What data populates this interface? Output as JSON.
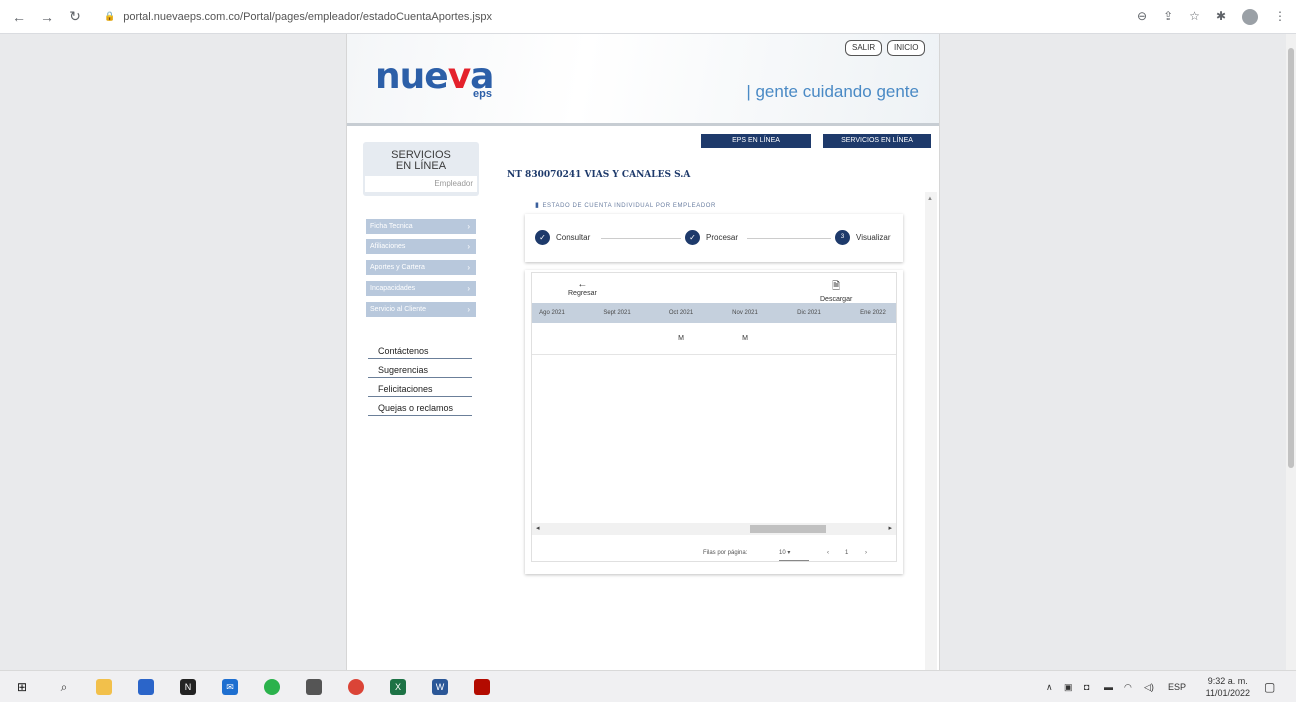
{
  "browser": {
    "url": "portal.nuevaeps.com.co/Portal/pages/empleador/estadoCuentaAportes.jspx"
  },
  "header": {
    "logo_text_main": "nue",
    "logo_text_v": "v",
    "logo_text_end": "a",
    "logo_eps": "eps",
    "slogan": "| gente cuidando gente",
    "salir_label": "SALIR",
    "inicio_label": "INICIO"
  },
  "sidebar": {
    "services_title_line1": "SERVICIOS",
    "services_title_line2": "EN LÍNEA",
    "services_sub": "Empleador",
    "menu": [
      {
        "label": "Ficha Tecnica"
      },
      {
        "label": "Afiliaciones"
      },
      {
        "label": "Aportes y Cartera"
      },
      {
        "label": "Incapacidades"
      },
      {
        "label": "Servicio al Cliente"
      }
    ],
    "links": [
      {
        "label": "Contáctenos"
      },
      {
        "label": "Sugerencias"
      },
      {
        "label": "Felicitaciones"
      },
      {
        "label": "Quejas o reclamos"
      }
    ]
  },
  "top_buttons": {
    "eps_label": "EPS EN LÍNEA",
    "servicios_label": "SERVICIOS EN LÍNEA"
  },
  "company": "NT 830070241 VIAS Y CANALES S.A",
  "section_title": "ESTADO DE CUENTA INDIVIDUAL POR EMPLEADOR",
  "stepper": {
    "steps": [
      {
        "label": "Consultar",
        "status": "done"
      },
      {
        "label": "Procesar",
        "status": "done"
      },
      {
        "label": "Visualizar",
        "status": "current",
        "number": "3"
      }
    ]
  },
  "table": {
    "regresar_label": "Regresar",
    "descargar_label": "Descargar",
    "columns": [
      "Ago 2021",
      "Sept 2021",
      "Oct 2021",
      "Nov 2021",
      "Dic 2021",
      "Ene 2022"
    ],
    "rows": [
      [
        "",
        "",
        "M",
        "M",
        "",
        ""
      ]
    ],
    "pager": {
      "rows_per_page_label": "Filas por página:",
      "rows_per_page_value": "10",
      "page": "1"
    }
  },
  "taskbar": {
    "lang": "ESP",
    "time": "9:32 a. m.",
    "date": "11/01/2022"
  },
  "colors": {
    "brand_blue": "#2c5fa8",
    "brand_red": "#e4212c",
    "navy": "#1e3a6b"
  }
}
